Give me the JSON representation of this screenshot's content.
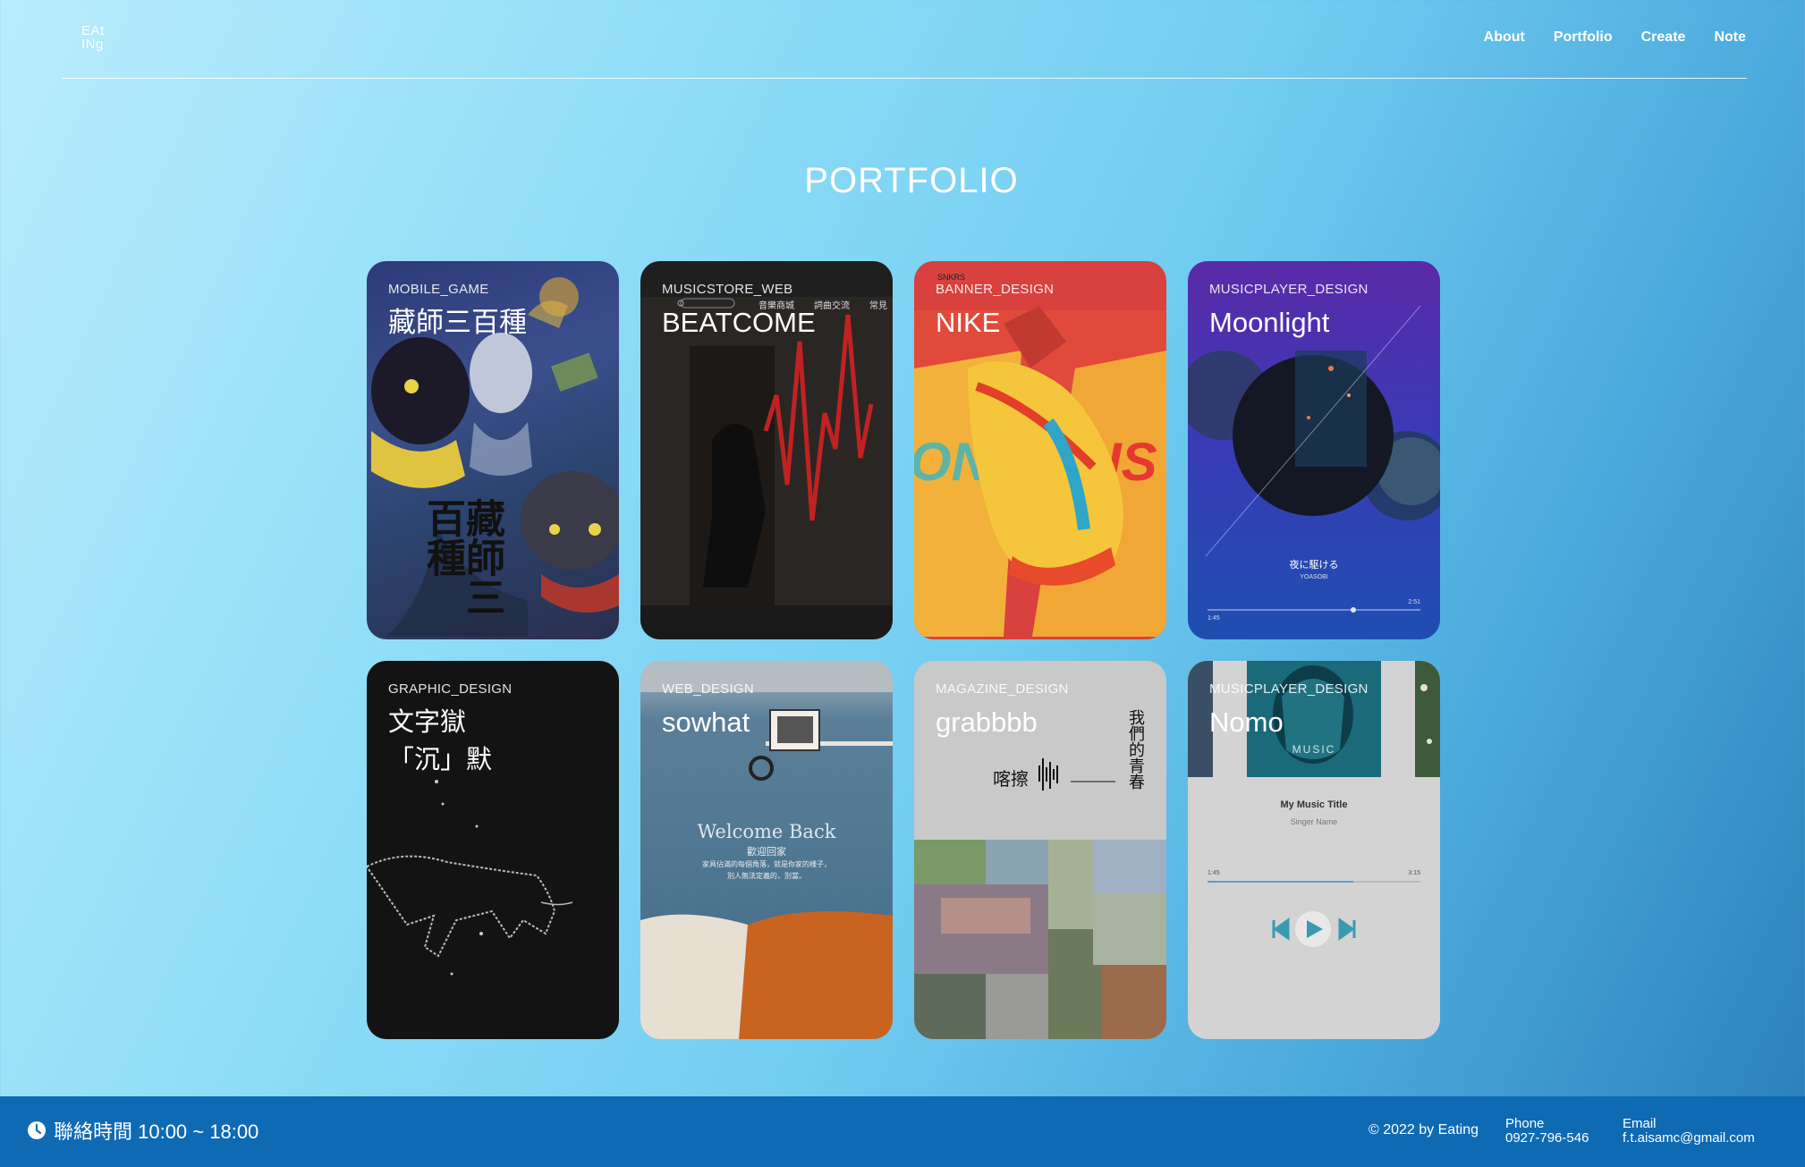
{
  "header": {
    "logo_line1": "EAt",
    "logo_line2": "INg",
    "nav": [
      "About",
      "Portfolio",
      "Create",
      "Note"
    ]
  },
  "page_title": "PORTFOLIO",
  "cards": [
    {
      "category": "MOBILE_GAME",
      "title": "藏師三百種"
    },
    {
      "category": "MUSICSTORE_WEB",
      "title": "BEATCOME"
    },
    {
      "category": "BANNER_DESIGN",
      "title": "NIKE"
    },
    {
      "category": "MUSICPLAYER_DESIGN",
      "title": "Moonlight"
    },
    {
      "category": "GRAPHIC_DESIGN",
      "title": "文字獄\n「沉」默"
    },
    {
      "category": "WEB_DESIGN",
      "title": "sowhat"
    },
    {
      "category": "MAGAZINE_DESIGN",
      "title": "grabbbb"
    },
    {
      "category": "MUSICPLAYER_DESIGN",
      "title": "Nomo"
    }
  ],
  "card_art": {
    "game_calligraphy": "藏師三百種",
    "beatcome_nav": [
      "音樂商城",
      "詞曲交流",
      "常見"
    ],
    "nike_brand": "SNKRS",
    "moonlight_song": "夜に駆ける",
    "moonlight_artist": "YOASOBI",
    "moonlight_time_start": "1:45",
    "moonlight_time_end": "2:51",
    "sowhat_welcome": "Welcome Back",
    "sowhat_sub": "歡迎回家",
    "sowhat_line1": "家具佔滿的每個角落，就是你家的樣子，",
    "sowhat_line2": "別人無法定義的，別當。",
    "magazine_vertical": "我們的青春",
    "magazine_sound": "喀擦",
    "nomo_cover_label": "MUSIC",
    "nomo_song_title": "My Music Title",
    "nomo_singer": "Singer Name",
    "nomo_time_start": "1:45",
    "nomo_time_end": "3:15"
  },
  "footer": {
    "hours": "聯絡時間 10:00 ~ 18:00",
    "copyright": "© 2022 by Eating",
    "phone_label": "Phone",
    "phone": "0927-796-546",
    "email_label": "Email",
    "email": "f.t.aisamc@gmail.com"
  },
  "colors": {
    "footer_bg": "#0f6ab4",
    "nomo_accent": "#3a9bb0"
  }
}
